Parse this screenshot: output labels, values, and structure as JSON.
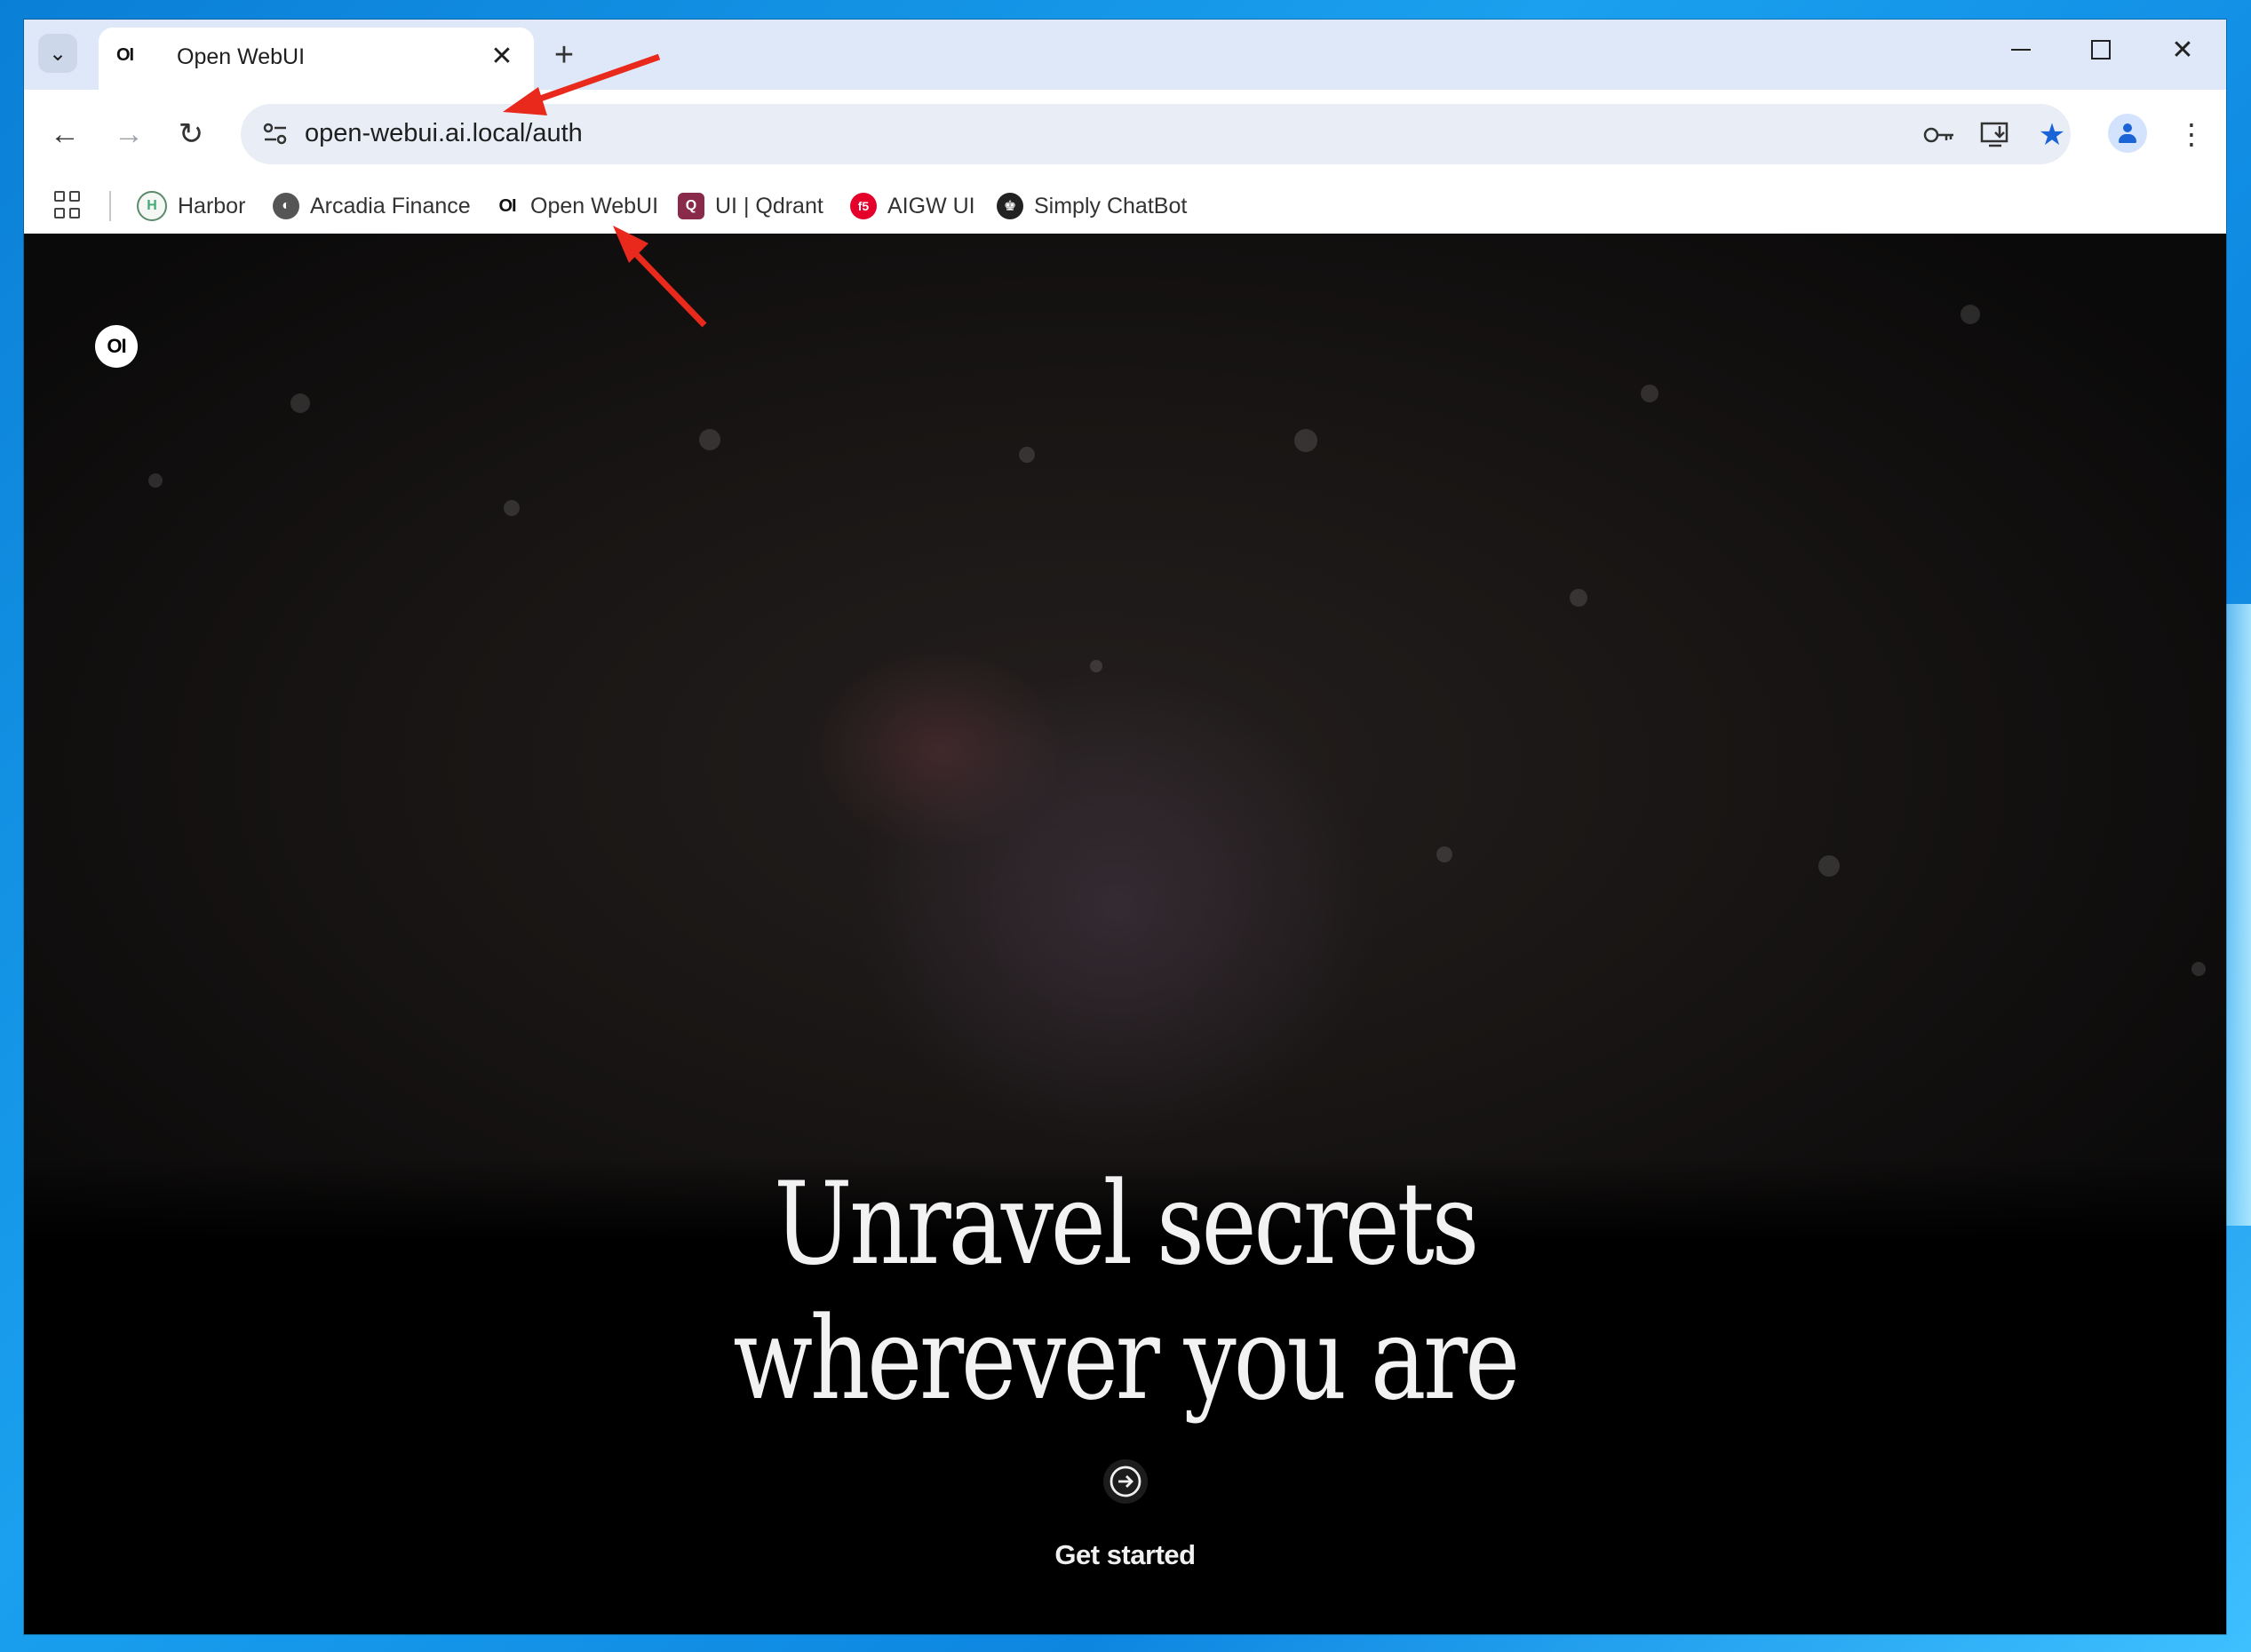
{
  "browser": {
    "tab": {
      "favicon": "OI",
      "title": "Open WebUI"
    },
    "address_bar": {
      "url": "open-webui.ai.local/auth"
    },
    "icons": {
      "tab_search": "chevron-down-icon",
      "close_tab": "close-icon",
      "new_tab": "plus-icon",
      "back": "arrow-left-icon",
      "forward": "arrow-right-icon",
      "reload": "reload-icon",
      "site_info": "tune-icon",
      "password": "key-icon",
      "install": "install-icon",
      "bookmark": "star-icon",
      "profile": "profile-icon",
      "menu": "more-vertical-icon"
    },
    "glyphs": {
      "tab_search": "⌄",
      "close_tab": "✕",
      "new_tab": "+",
      "back": "←",
      "forward": "→",
      "reload": "↻",
      "site_info": "⚙",
      "password": "⚷",
      "install": "⎙",
      "bookmark": "★",
      "menu": "⋮",
      "close_window": "✕"
    },
    "bookmarks": [
      {
        "label": "Harbor",
        "icon": "harbor-icon",
        "glyph": "H"
      },
      {
        "label": "Arcadia Finance",
        "icon": "globe-icon",
        "glyph": "◐"
      },
      {
        "label": "Open WebUI",
        "icon": "openwebui-icon",
        "glyph": "OI"
      },
      {
        "label": "UI | Qdrant",
        "icon": "qdrant-icon",
        "glyph": "Q"
      },
      {
        "label": "AIGW UI",
        "icon": "f5-icon",
        "glyph": "f5"
      },
      {
        "label": "Simply ChatBot",
        "icon": "chatbot-icon",
        "glyph": "♚"
      }
    ]
  },
  "page": {
    "logo": "OI",
    "headline_line1": "Unravel secrets",
    "headline_line2": "wherever you are",
    "cta_label": "Get started"
  },
  "colors": {
    "accent": "#1a64d6",
    "annotation_arrow": "#e8291b",
    "background": "#000000"
  }
}
